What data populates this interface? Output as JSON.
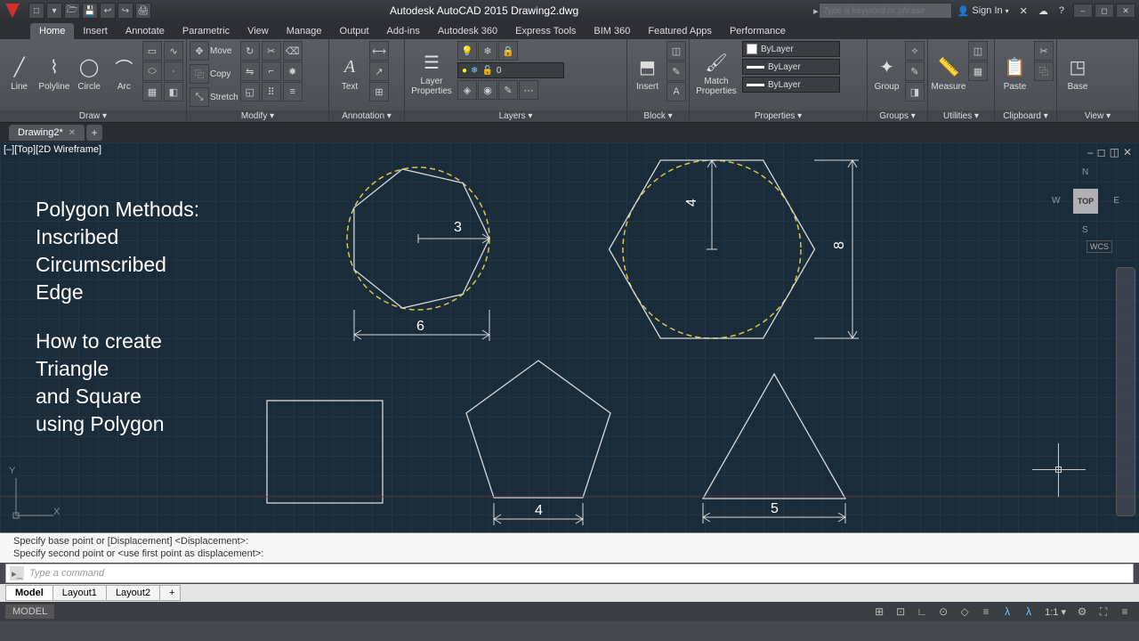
{
  "app": {
    "title": "Autodesk AutoCAD 2015   Drawing2.dwg",
    "search_placeholder": "Type a keyword or phrase",
    "signin": "Sign In"
  },
  "qat": [
    "□",
    "▾",
    "🗁",
    "💾",
    "↩",
    "↪",
    "🖨"
  ],
  "menu": {
    "tabs": [
      "Home",
      "Insert",
      "Annotate",
      "Parametric",
      "View",
      "Manage",
      "Output",
      "Add-ins",
      "Autodesk 360",
      "Express Tools",
      "BIM 360",
      "Featured Apps",
      "Performance"
    ],
    "active": 0
  },
  "ribbon": {
    "draw": {
      "title": "Draw ▾",
      "line": "Line",
      "polyline": "Polyline",
      "circle": "Circle",
      "arc": "Arc"
    },
    "modify": {
      "title": "Modify ▾",
      "move": "Move",
      "copy": "Copy",
      "stretch": "Stretch"
    },
    "annotation": {
      "title": "Annotation ▾",
      "text": "Text"
    },
    "layers": {
      "title": "Layers ▾",
      "btn": "Layer\nProperties",
      "current": "0"
    },
    "block": {
      "title": "Block ▾",
      "insert": "Insert"
    },
    "properties": {
      "title": "Properties ▾",
      "match": "Match\nProperties",
      "bylayer": "ByLayer"
    },
    "groups": {
      "title": "Groups ▾",
      "group": "Group"
    },
    "utilities": {
      "title": "Utilities ▾",
      "measure": "Measure"
    },
    "clipboard": {
      "title": "Clipboard ▾",
      "paste": "Paste"
    },
    "view": {
      "title": "View ▾",
      "base": "Base"
    }
  },
  "document": {
    "tab": "Drawing2*",
    "viewport": "[‒][Top][2D Wireframe]"
  },
  "overlay": {
    "l1": "Polygon Methods:",
    "l2": "Inscribed",
    "l3": "Circumscribed",
    "l4": "Edge",
    "l5": "How to create",
    "l6": "Triangle",
    "l7": "and Square",
    "l8": "using Polygon"
  },
  "dims": {
    "d3": "3",
    "d6": "6",
    "d4a": "4",
    "d8": "8",
    "d4b": "4",
    "d5": "5"
  },
  "viewcube": {
    "top": "TOP",
    "n": "N",
    "s": "S",
    "e": "E",
    "w": "W",
    "wcs": "WCS"
  },
  "ucs": {
    "x": "X",
    "y": "Y"
  },
  "cmd": {
    "hist1": "Specify base point or [Displacement] <Displacement>:",
    "hist2": "Specify second point or <use first point as displacement>:",
    "placeholder": "Type a command"
  },
  "layouts": {
    "tabs": [
      "Model",
      "Layout1",
      "Layout2"
    ],
    "active": 0,
    "add": "+"
  },
  "status": {
    "model": "MODEL",
    "scale": "1:1 ▾"
  }
}
